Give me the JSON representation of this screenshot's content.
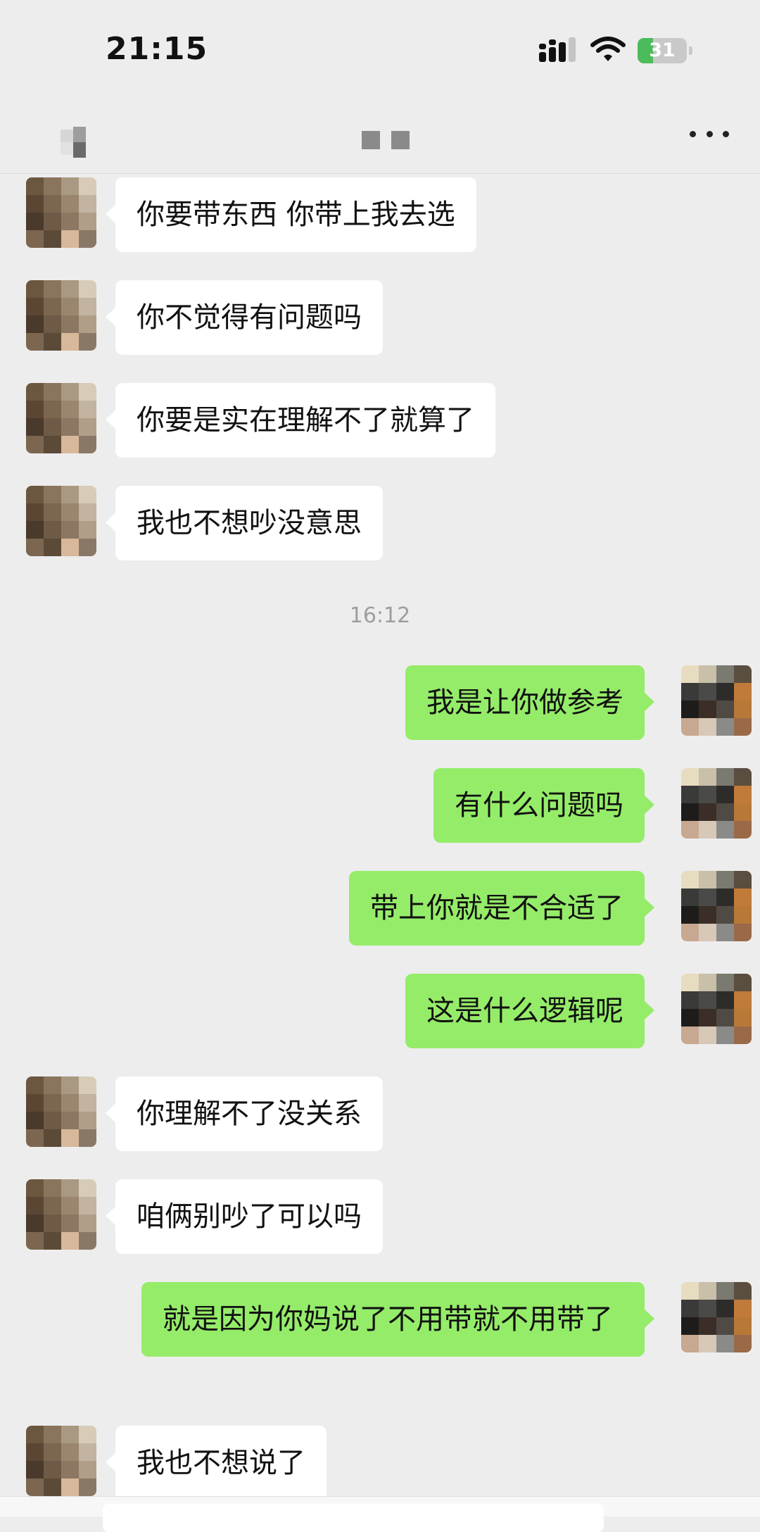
{
  "status_bar": {
    "time": "21:15",
    "battery": "31",
    "battery_level": 0.31,
    "signal_icon": "cellular-signal-icon",
    "wifi_icon": "wifi-icon"
  },
  "nav": {
    "more_icon": "more-dots-icon"
  },
  "messages": [
    {
      "side": "left",
      "text": "你要带东西 你带上我去选"
    },
    {
      "side": "left",
      "text": "你不觉得有问题吗"
    },
    {
      "side": "left",
      "text": "你要是实在理解不了就算了"
    },
    {
      "side": "left",
      "text": "我也不想吵没意思"
    },
    {
      "type": "timestamp",
      "text": "16:12"
    },
    {
      "side": "right",
      "text": "我是让你做参考"
    },
    {
      "side": "right",
      "text": "有什么问题吗"
    },
    {
      "side": "right",
      "text": "带上你就是不合适了"
    },
    {
      "side": "right",
      "text": "这是什么逻辑呢"
    },
    {
      "side": "left",
      "text": "你理解不了没关系"
    },
    {
      "side": "left",
      "text": "咱俩别吵了可以吗"
    },
    {
      "side": "right",
      "text": "就是因为你妈说了不用带就不用带了"
    },
    {
      "side": "left",
      "text": "我也不想说了"
    }
  ],
  "colors": {
    "background": "#ededed",
    "bubble_self": "#95ec69",
    "bubble_other": "#ffffff",
    "timestamp": "#9e9e9e"
  }
}
